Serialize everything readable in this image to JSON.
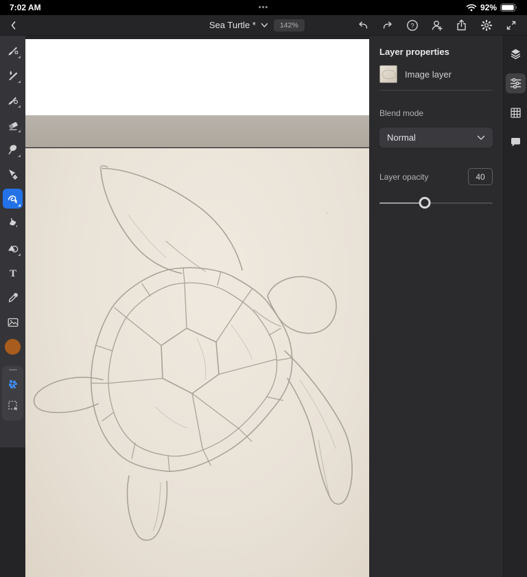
{
  "status_bar": {
    "time": "7:02 AM",
    "menu_dots": "•••",
    "battery_percent": "92%"
  },
  "toolbar": {
    "document_title": "Sea Turtle *",
    "zoom_level": "142%",
    "help_glyph": "?",
    "icons": [
      "back",
      "undo",
      "redo",
      "help",
      "invite-collaborator",
      "share",
      "settings",
      "fullscreen"
    ]
  },
  "tool_sidebar": {
    "tools": [
      "brush-tool",
      "watercolor-brush-tool",
      "oil-brush-tool",
      "eraser-tool",
      "lasso-tool",
      "move-tool",
      "selection-brush-tool",
      "paint-bucket-tool",
      "shapes-tool",
      "type-tool",
      "eyedropper-tool",
      "place-image-tool",
      "color-swatch",
      "pixel-selection-tool",
      "transform-selection-tool"
    ],
    "active_tool": "selection-brush-tool",
    "type_tool_glyph": "T",
    "color_swatch_color": "#a85c1e",
    "accent_color": "#2472e8"
  },
  "layer_panel": {
    "title": "Layer properties",
    "layer_name": "Image layer",
    "blend_mode_label": "Blend mode",
    "blend_mode_value": "Normal",
    "opacity_label": "Layer opacity",
    "opacity_value": "40",
    "opacity_percent": 40
  },
  "right_rail": {
    "items": [
      "layers",
      "properties",
      "grid",
      "comments"
    ],
    "active": "properties"
  },
  "canvas": {
    "content_description": "Photo of a pencil sketch of a sea turtle on cream paper, white empty canvas band above"
  }
}
